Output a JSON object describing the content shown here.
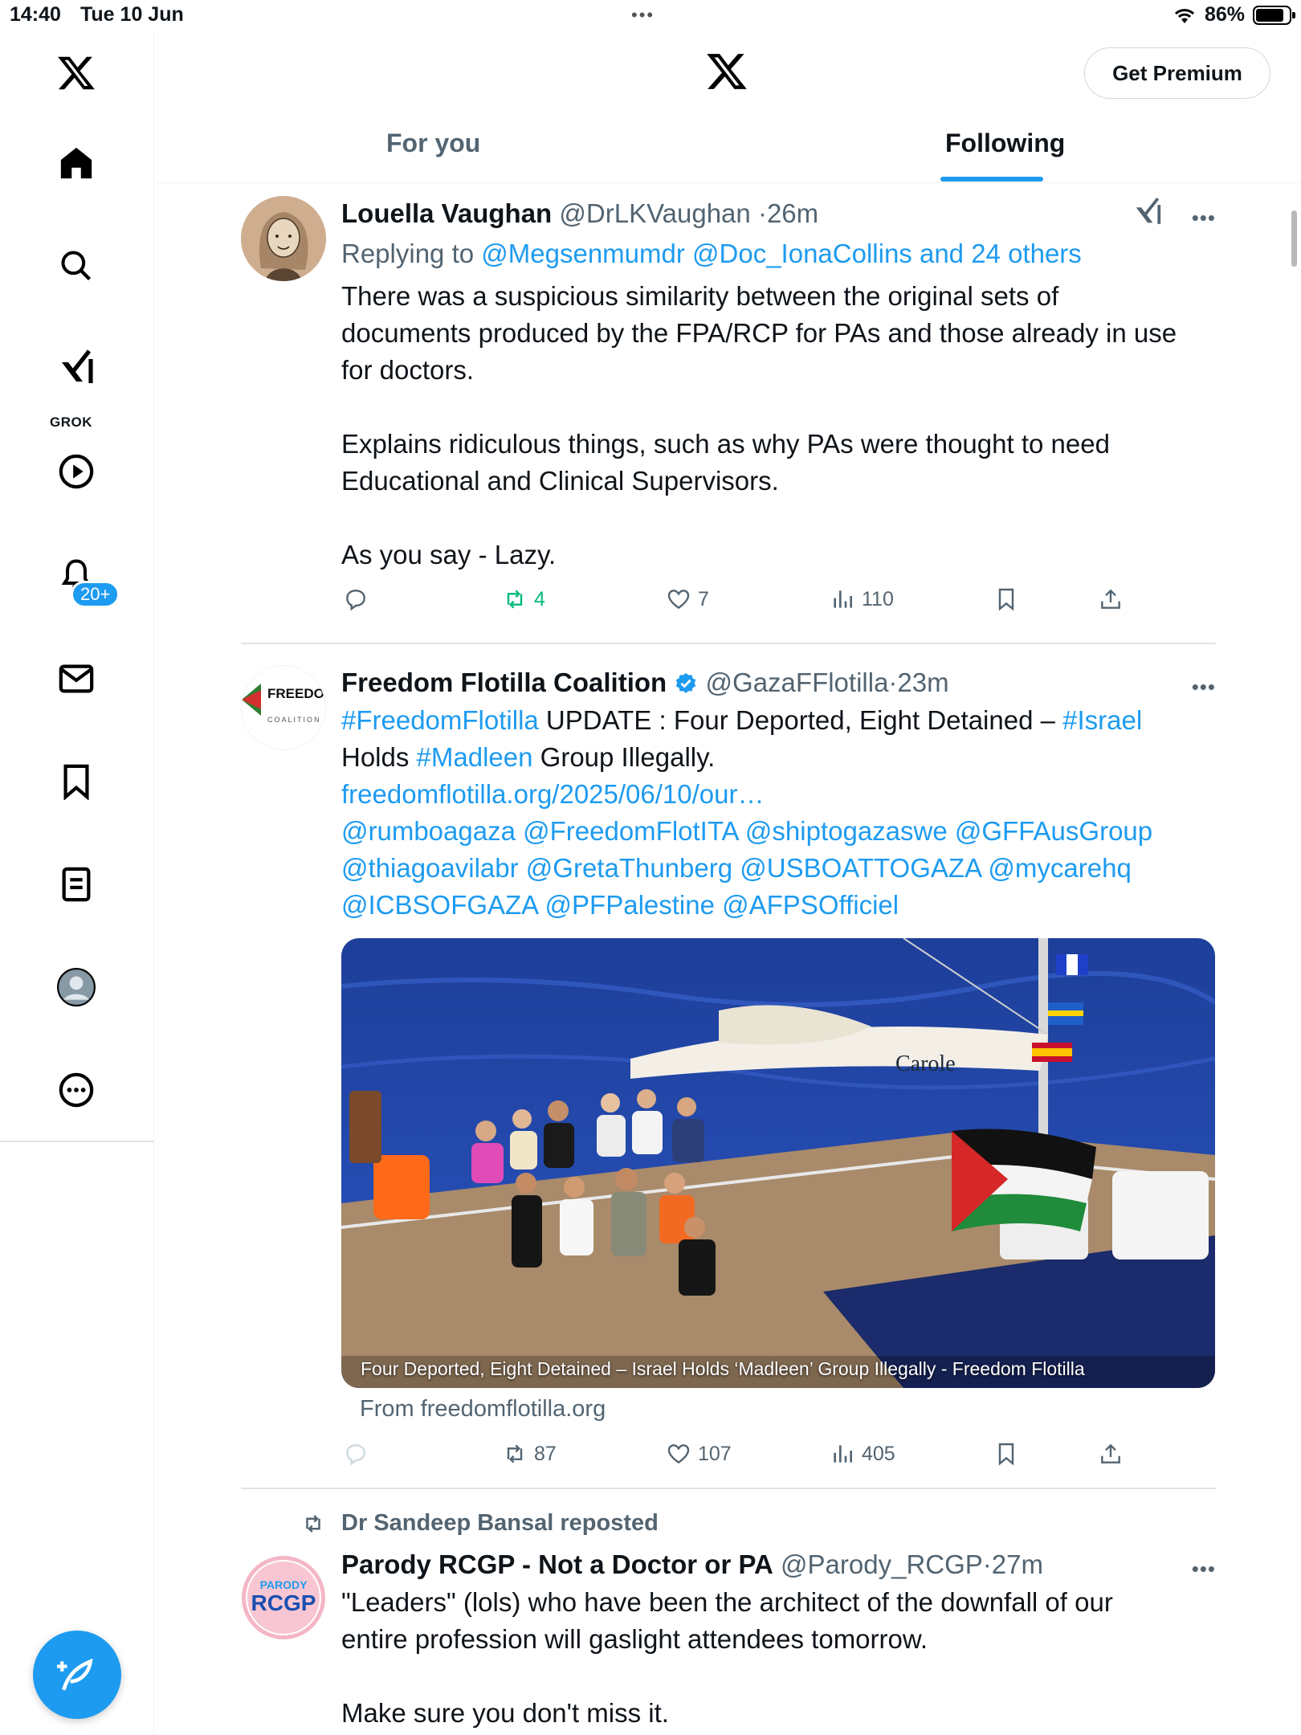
{
  "status_bar": {
    "time": "14:40",
    "date": "Tue 10 Jun",
    "battery": "86%",
    "battery_level": 0.86
  },
  "sidebar": {
    "grok_label": "GROK",
    "notifications_badge": "20+"
  },
  "header": {
    "premium_label": "Get Premium",
    "tabs": [
      {
        "label": "For you",
        "active": false
      },
      {
        "label": "Following",
        "active": true
      }
    ]
  },
  "posts": [
    {
      "author": "Louella Vaughan",
      "handle": "@DrLKVaughan",
      "sep": "·",
      "time": "26m",
      "replying_prefix": "Replying to ",
      "replying_to": "@Megsenmumdr @Doc_IonaCollins and 24 others",
      "body": [
        "There was a suspicious similarity between the original sets of",
        "documents produced by the FPA/RCP for PAs and those already in use",
        "for doctors.",
        "",
        "Explains ridiculous things, such as why PAs were thought to need",
        "Educational and Clinical Supervisors.",
        "",
        "As you say - Lazy."
      ],
      "stats": {
        "replies": "",
        "reposts": "4",
        "likes": "7",
        "views": "110"
      }
    },
    {
      "author": "Freedom Flotilla Coalition",
      "handle": "@GazaFFlotilla",
      "sep": "·",
      "time": "23m",
      "avatar_text": "FREEDOM FLOTILLA",
      "avatar_sub": "COALITION",
      "body": {
        "l1_tag1": "#FreedomFlotilla",
        "l1_text": " UPDATE : Four Deported, Eight Detained – ",
        "l1_tag2": "#Israel",
        "l2_pre": "Holds ",
        "l2_tag": "#Madleen",
        "l2_post": " Group Illegally.",
        "url": "freedomflotilla.org/2025/06/10/our…",
        "mentions1": "@rumboagaza @FreedomFlotITA @shiptogazaswe @GFFAusGroup",
        "mentions2": "@thiagoavilabr @GretaThunberg @USBOATTOGAZA @mycarehq",
        "mentions3": "@ICBSOFGAZA @PFPalestine @AFPSOfficiel"
      },
      "card": {
        "caption": "Four Deported, Eight Detained – Israel Holds ‘Madleen’ Group Illegally - Freedom Flotilla",
        "boat_name": "Carole",
        "from": "From freedomflotilla.org"
      },
      "stats": {
        "replies": "",
        "reposts": "87",
        "likes": "107",
        "views": "405"
      }
    },
    {
      "repost_by": "Dr Sandeep Bansal reposted",
      "author": "Parody RCGP - Not a Doctor or PA",
      "handle": "@Parody_RCGP",
      "sep": "·",
      "time": "27m",
      "avatar_top": "PARODY",
      "avatar_main": "RCGP",
      "body": [
        "\"Leaders\" (lols) who have been the architect of the downfall of our",
        "entire profession will gaslight attendees tomorrow.",
        "",
        "Make sure you don't miss it."
      ]
    }
  ],
  "colors": {
    "accent": "#1d9bf0",
    "text": "#0f1419",
    "muted": "#536471",
    "repost_green": "#00ba7c"
  }
}
